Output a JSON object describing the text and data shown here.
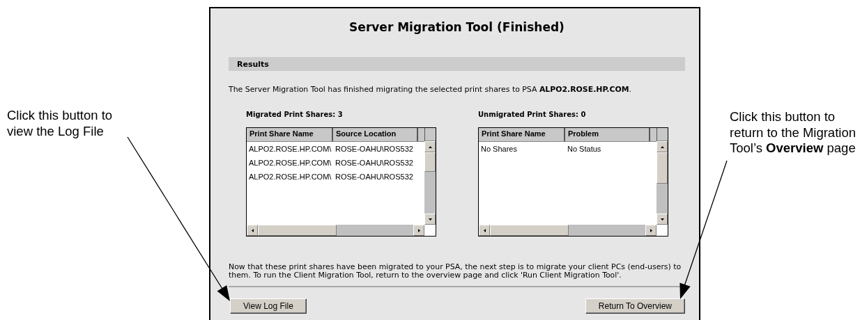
{
  "window": {
    "title": "Server Migration Tool (Finished)"
  },
  "results": {
    "heading": "Results",
    "message": "The Server Migration Tool has finished migrating the selected print shares to PSA **ALPO2.ROSE.HP.COM**.",
    "tables": [
      {
        "caption": "Migrated Print Shares: 3",
        "columns": [
          "Print Share Name",
          "Source Location"
        ],
        "rows": [
          [
            "ALPO2.ROSE.HP.COM\\",
            "ROSE-OAHU\\ROS532"
          ],
          [
            "ALPO2.ROSE.HP.COM\\",
            "ROSE-OAHU\\ROS532"
          ],
          [
            "ALPO2.ROSE.HP.COM\\",
            "ROSE-OAHU\\ROS532"
          ]
        ]
      },
      {
        "caption": "Unmigrated Print Shares: 0",
        "columns": [
          "Print Share Name",
          "Problem"
        ],
        "rows": [
          [
            "No Shares",
            "No Status"
          ]
        ]
      }
    ],
    "note": "Now that these print shares have been migrated to your PSA, the next step is to migrate your client PCs (end-users) to them. To run the Client Migration Tool, return to the overview page and click 'Run Client Migration Tool'."
  },
  "buttons": [
    {
      "label": "View Log File"
    },
    {
      "label": "Return To Overview"
    }
  ],
  "callouts": [
    {
      "text": "Click this button to view the Log File"
    },
    {
      "text": "Click this button to return to the Migration Tool’s **Overview** page"
    }
  ]
}
